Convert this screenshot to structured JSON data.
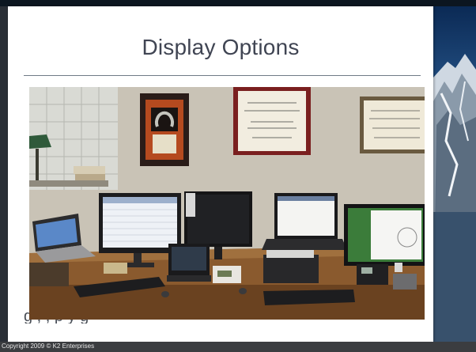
{
  "slide": {
    "title": "Display Options",
    "obscured_text": "g ,   ,                       p  y  g"
  },
  "footer": {
    "copyright": "Copyright 2009 © K2 Enterprises"
  },
  "colors": {
    "title": "#404553",
    "rule": "#6f7b86",
    "footer_bg": "#3b3d40"
  }
}
